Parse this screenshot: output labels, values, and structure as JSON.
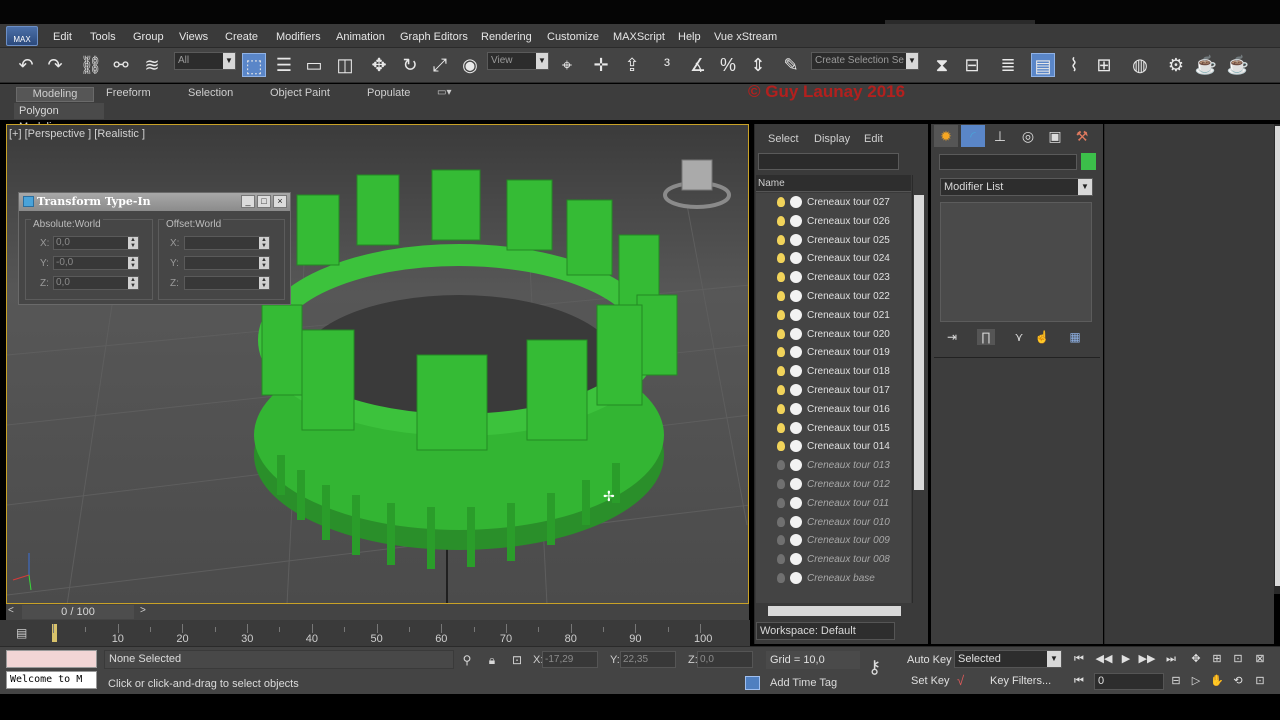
{
  "app": {
    "logo_text": "MAX"
  },
  "menu": [
    "Edit",
    "Tools",
    "Group",
    "Views",
    "Create",
    "Modifiers",
    "Animation",
    "Graph Editors",
    "Rendering",
    "Customize",
    "MAXScript",
    "Help",
    "Vue xStream"
  ],
  "toolbar": {
    "filter_value": "All",
    "refcoord_value": "View",
    "selection_set_placeholder": "Create Selection Se",
    "icons": [
      "undo-icon",
      "redo-icon",
      "link-icon",
      "unlink-icon",
      "bind-space-warp-icon",
      "select-object-icon",
      "select-by-name-icon",
      "rect-selection-icon",
      "window-crossing-icon",
      "move-icon",
      "rotate-icon",
      "scale-icon",
      "select-and-place-icon",
      "use-pivot-icon",
      "move-manipulate-icon",
      "snap-icon",
      "angle-snap-icon",
      "percent-snap-icon",
      "spinner-snap-icon",
      "edit-named-sets-icon",
      "mirror-icon",
      "align-icon",
      "layer-icon",
      "scene-explorer-icon",
      "curve-editor-icon",
      "schematic-icon",
      "material-editor-icon",
      "render-setup-icon",
      "render-frame-icon",
      "render-icon"
    ]
  },
  "ribbon": {
    "tabs": [
      "Modeling",
      "Freeform",
      "Selection",
      "Object Paint",
      "Populate"
    ],
    "sub_label": "Polygon Modeling",
    "watermark": "© Guy Launay 2016"
  },
  "viewport": {
    "label": "[+] [Perspective ] [Realistic ]"
  },
  "transform_typein": {
    "title": "Transform Type-In",
    "absolute_label": "Absolute:World",
    "offset_label": "Offset:World",
    "axes": [
      "X:",
      "Y:",
      "Z:"
    ],
    "absolute_values": [
      "0,0",
      "-0,0",
      "0,0"
    ],
    "offset_values": [
      "",
      "",
      ""
    ]
  },
  "explorer": {
    "tabs": [
      "Select",
      "Display",
      "Edit"
    ],
    "column_header": "Name",
    "items": [
      {
        "name": "Creneaux tour 027",
        "visible": true
      },
      {
        "name": "Creneaux tour 026",
        "visible": true
      },
      {
        "name": "Creneaux tour 025",
        "visible": true
      },
      {
        "name": "Creneaux tour 024",
        "visible": true
      },
      {
        "name": "Creneaux tour 023",
        "visible": true
      },
      {
        "name": "Creneaux tour 022",
        "visible": true
      },
      {
        "name": "Creneaux tour 021",
        "visible": true
      },
      {
        "name": "Creneaux tour 020",
        "visible": true
      },
      {
        "name": "Creneaux tour 019",
        "visible": true
      },
      {
        "name": "Creneaux tour 018",
        "visible": true
      },
      {
        "name": "Creneaux tour 017",
        "visible": true
      },
      {
        "name": "Creneaux tour 016",
        "visible": true
      },
      {
        "name": "Creneaux tour 015",
        "visible": true
      },
      {
        "name": "Creneaux tour 014",
        "visible": true
      },
      {
        "name": "Creneaux tour 013",
        "visible": false
      },
      {
        "name": "Creneaux tour 012",
        "visible": false
      },
      {
        "name": "Creneaux tour 011",
        "visible": false
      },
      {
        "name": "Creneaux tour 010",
        "visible": false
      },
      {
        "name": "Creneaux tour 009",
        "visible": false
      },
      {
        "name": "Creneaux tour 008",
        "visible": false
      },
      {
        "name": "Creneaux base",
        "visible": false
      }
    ],
    "workspace": "Workspace: Default"
  },
  "command_panel": {
    "modifier_list": "Modifier List",
    "object_color": "#3cbf4a"
  },
  "timeline": {
    "frame_display": "0 / 100",
    "ticks": [
      "10",
      "20",
      "30",
      "40",
      "50",
      "60",
      "70",
      "80",
      "90",
      "100"
    ]
  },
  "status": {
    "listener_text": "Welcome to M",
    "selection": "None Selected",
    "prompt": "Click or click-and-drag to select objects",
    "x_label": "X:",
    "x_value": "-17,29",
    "y_label": "Y:",
    "y_value": "22,35",
    "z_label": "Z:",
    "z_value": "0,0",
    "grid": "Grid = 10,0",
    "add_time_tag": "Add Time Tag",
    "auto_key": "Auto Key",
    "set_key": "Set Key",
    "key_mode": "Selected",
    "key_filters": "Key Filters...",
    "current_frame": "0"
  },
  "colors": {
    "accent_blue": "#5a86c8",
    "viewport_border": "#c9a227",
    "tower_green": "#33b533",
    "watermark_red": "#b3201e"
  }
}
